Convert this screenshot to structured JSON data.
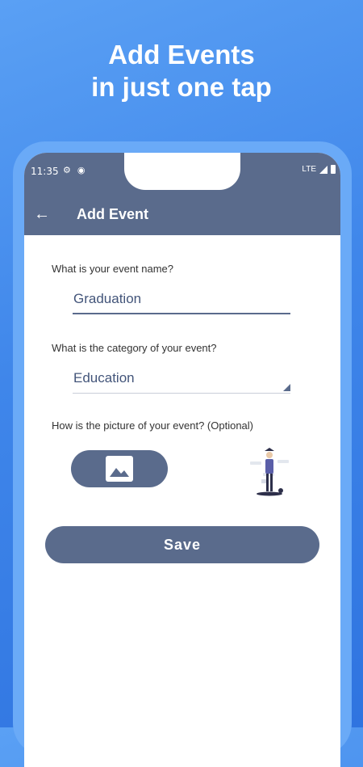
{
  "promo": {
    "line1": "Add Events",
    "line2": "in just one tap"
  },
  "status_bar": {
    "time": "11:35",
    "network": "LTE"
  },
  "app_bar": {
    "title": "Add Event"
  },
  "form": {
    "name_label": "What is your event name?",
    "name_value": "Graduation",
    "category_label": "What is the category of your event?",
    "category_value": "Education",
    "picture_label": "How is the picture of your event? (Optional)"
  },
  "actions": {
    "save_label": "Save"
  },
  "colors": {
    "accent": "#5a6b8c",
    "background": "#3f86ea"
  }
}
